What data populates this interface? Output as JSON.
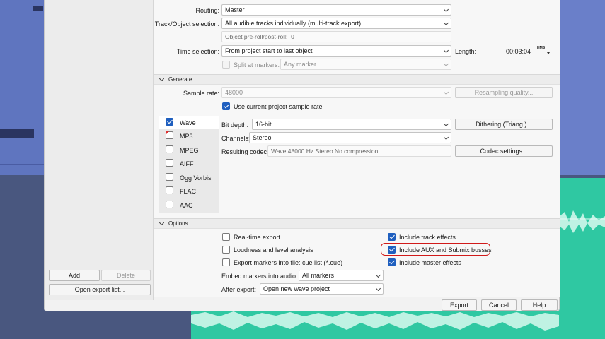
{
  "left_panel": {
    "add_label": "Add",
    "delete_label": "Delete",
    "open_list_label": "Open export list..."
  },
  "routing": {
    "label": "Routing:",
    "value": "Master"
  },
  "track_selection": {
    "label": "Track/Object selection:",
    "value": "All audible tracks individually (multi-track export)"
  },
  "preroll": {
    "label": "Object pre-roll/post-roll:",
    "value": "0"
  },
  "time_selection": {
    "label": "Time selection:",
    "value": "From project start to last object"
  },
  "length": {
    "label": "Length:",
    "value": "00:03:04",
    "unit": "HMS"
  },
  "split": {
    "label": "Split at markers:",
    "value": "Any marker"
  },
  "generate": {
    "title": "Generate",
    "sample_rate_label": "Sample rate:",
    "sample_rate_value": "48000",
    "resampling_label": "Resampling quality...",
    "use_current_label": "Use current project sample rate",
    "bit_depth_label": "Bit depth:",
    "bit_depth_value": "16-bit",
    "dithering_label": "Dithering (Triang.)...",
    "channels_label": "Channels:",
    "channels_value": "Stereo",
    "codec_label": "Resulting codec:",
    "codec_value": "Wave 48000 Hz  Stereo  No compression",
    "codec_settings_label": "Codec settings...",
    "formats": [
      {
        "name": "Wave",
        "checked": true
      },
      {
        "name": "MP3",
        "checked": false
      },
      {
        "name": "MPEG",
        "checked": false
      },
      {
        "name": "AIFF",
        "checked": false
      },
      {
        "name": "Ogg Vorbis",
        "checked": false
      },
      {
        "name": "FLAC",
        "checked": false
      },
      {
        "name": "AAC",
        "checked": false
      }
    ]
  },
  "options": {
    "title": "Options",
    "realtime": "Real-time export",
    "loudness": "Loudness and level analysis",
    "export_markers": "Export markers into file:",
    "export_markers_value": "cue list (*.cue)",
    "track_effects": "Include track effects",
    "aux_busses": "Include AUX and Submix busses",
    "master_effects": "Include master effects",
    "embed_label": "Embed markers into audio:",
    "embed_value": "All markers",
    "after_label": "After export:",
    "after_value": "Open new wave project"
  },
  "footer": {
    "export_label": "Export",
    "cancel_label": "Cancel",
    "help_label": "Help"
  },
  "colors": {
    "accent": "#1f5fbf",
    "highlight": "#d11a1a",
    "waveform": "#2fc8a2"
  }
}
